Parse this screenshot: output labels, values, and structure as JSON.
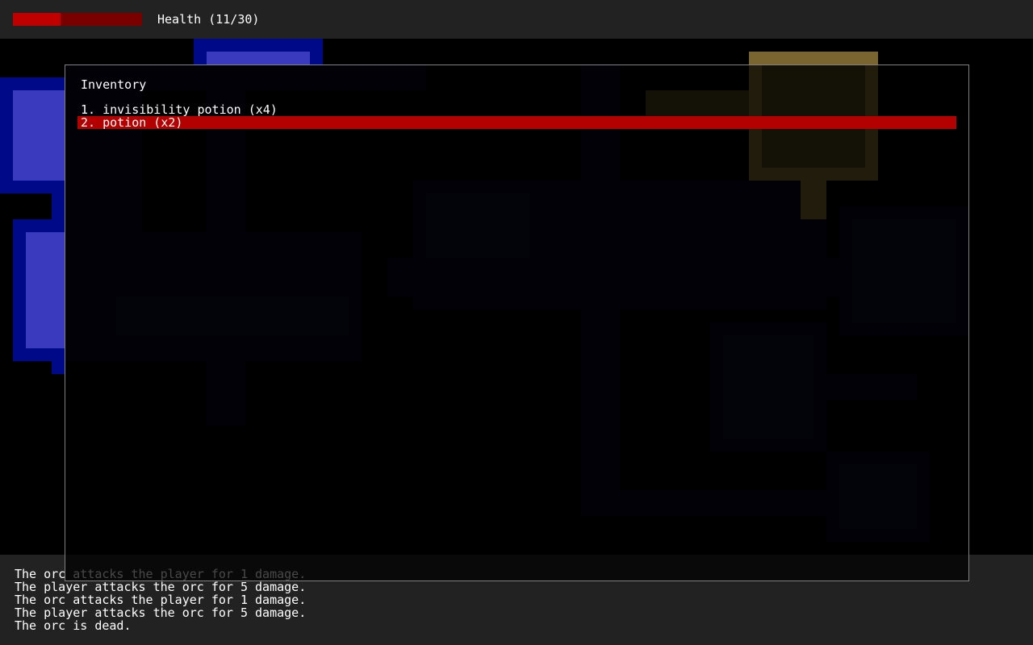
{
  "hud": {
    "health_label": "Health (11/30)",
    "health_current": 11,
    "health_max": 30,
    "bar_fill_color": "#c00000",
    "bar_empty_color": "#7a0000"
  },
  "inventory": {
    "title": "Inventory",
    "selected_index": 1,
    "items": [
      {
        "label": "1. invisibility potion (x4)"
      },
      {
        "label": "2. potion (x2)"
      }
    ]
  },
  "message_log": {
    "lines": [
      "The orc attacks the player for 1 damage.",
      "The player attacks the orc for 5 damage.",
      "The orc attacks the player for 1 damage.",
      "The player attacks the orc for 5 damage.",
      "The orc is dead."
    ]
  },
  "colors": {
    "panel_background": "#222222",
    "selection_highlight": "#b30000",
    "explored_wall": "#000a88",
    "explored_floor": "#3a3abf",
    "torch_area": "#7a6530"
  }
}
